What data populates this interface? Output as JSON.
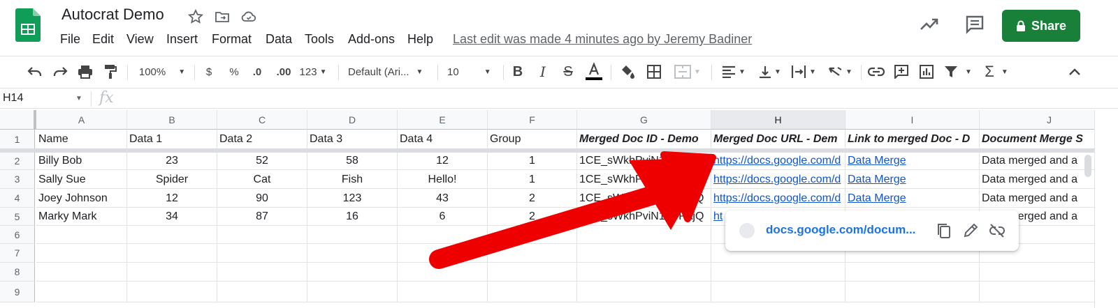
{
  "app": {
    "doc_title": "Autocrat Demo",
    "last_edit": "Last edit was made 4 minutes ago by Jeremy Badiner",
    "share_label": "Share"
  },
  "menu": [
    "File",
    "Edit",
    "View",
    "Insert",
    "Format",
    "Data",
    "Tools",
    "Add-ons",
    "Help"
  ],
  "toolbar": {
    "zoom": "100%",
    "currency": "$",
    "percent": "%",
    "decrease_decimal": ".0",
    "increase_decimal": ".00",
    "more_formats": "123",
    "font": "Default (Ari...",
    "font_size": "10"
  },
  "formula_bar": {
    "name_box": "H14",
    "fx": "fx"
  },
  "columns": [
    "A",
    "B",
    "C",
    "D",
    "E",
    "F",
    "G",
    "H",
    "I",
    "J"
  ],
  "selected_column": "H",
  "row_numbers": [
    "1",
    "2",
    "3",
    "4",
    "5",
    "6",
    "7",
    "8",
    "9"
  ],
  "header_row": [
    "Name",
    "Data 1",
    "Data 2",
    "Data 3",
    "Data 4",
    "Group",
    "Merged Doc ID - Demo",
    "Merged Doc URL - Dem",
    "Link to merged Doc - D",
    "Document Merge S"
  ],
  "rows": [
    [
      "Billy Bob",
      "23",
      "52",
      "58",
      "12",
      "1",
      "1CE_sWkhPviN1aYPAjQ",
      "https://docs.google.com/d",
      "Data Merge",
      "Data merged and a"
    ],
    [
      "Sally Sue",
      "Spider",
      "Cat",
      "Fish",
      "Hello!",
      "1",
      "1CE_sWkhPviN1aYPAjQ",
      "https://docs.google.com/d",
      "Data Merge",
      "Data merged and a"
    ],
    [
      "Joey Johnson",
      "12",
      "90",
      "123",
      "43",
      "2",
      "1CE_sWkhPviN1aYPAjQ",
      "https://docs.google.com/d",
      "Data Merge",
      "Data merged and a"
    ],
    [
      "Marky Mark",
      "34",
      "87",
      "16",
      "6",
      "2",
      "1CE_sWkhPviN1aYPAjQ",
      "ht",
      "",
      "Data merged and a"
    ]
  ],
  "link_popup": {
    "url": "docs.google.com/docum..."
  },
  "colors": {
    "share_green": "#188038",
    "link_blue": "#1155cc",
    "arrow_red": "#ee0000"
  }
}
